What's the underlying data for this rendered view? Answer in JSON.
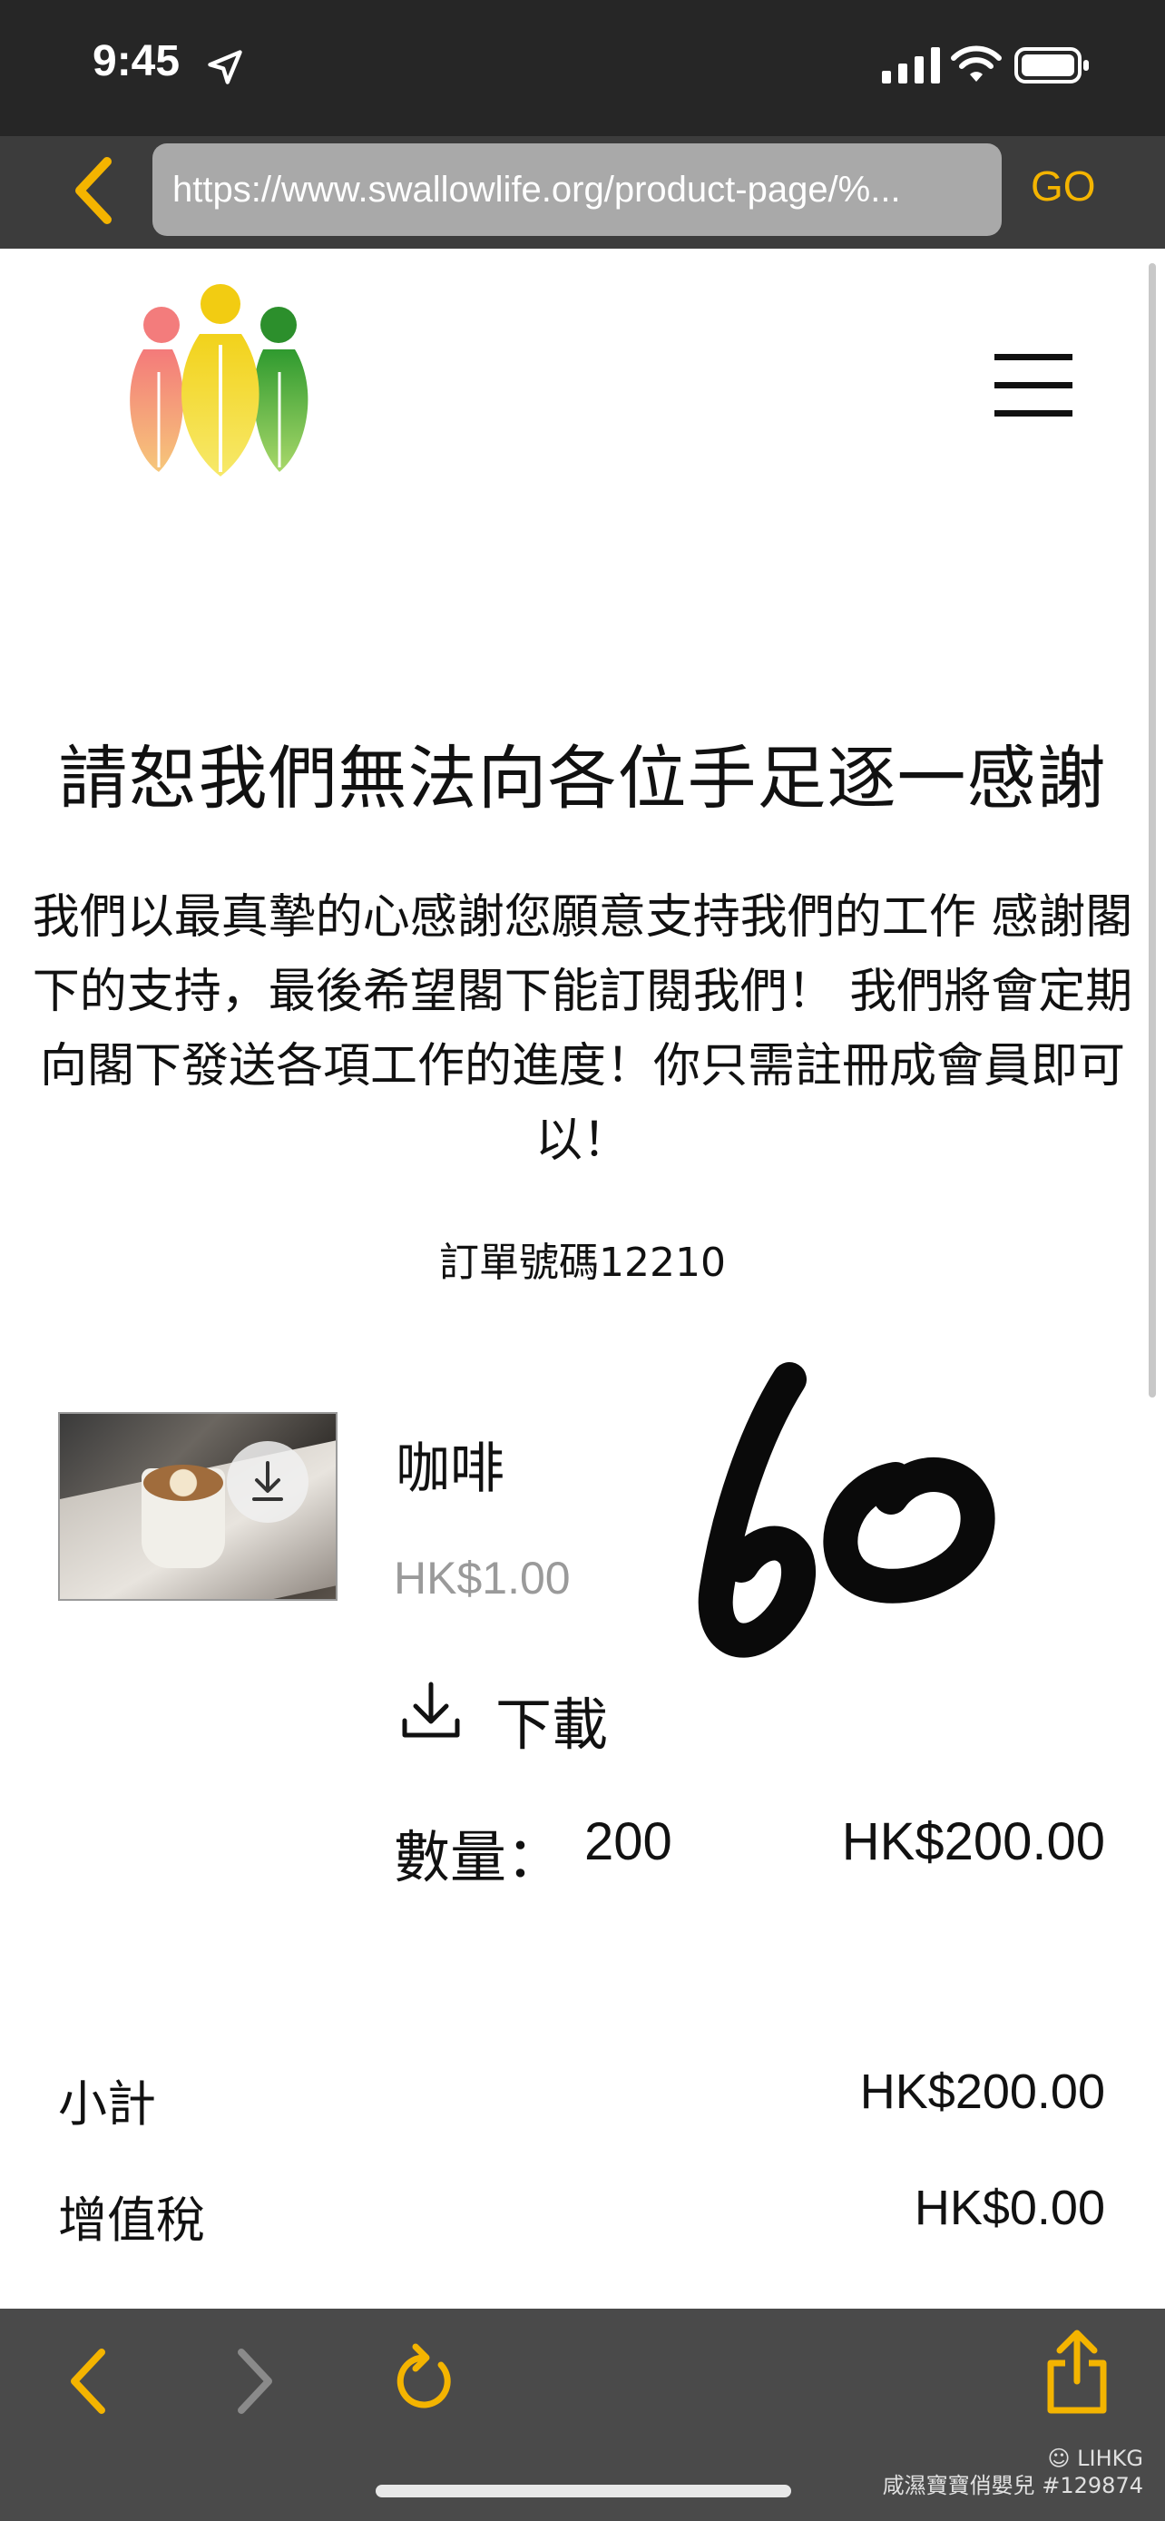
{
  "status_bar": {
    "time": "9:45"
  },
  "browser": {
    "url": "https://www.swallowlife.org/product-page/%...",
    "go_label": "GO"
  },
  "page": {
    "title": "請恕我們無法向各位手足逐一感謝",
    "description": "我們以最真摯的心感謝您願意支持我們的工作 感謝閣下的支持，最後希望閣下能訂閱我們！ 我們將會定期向閣下發送各項工作的進度！你只需註冊成會員即可以！",
    "order_number": "訂單號碼12210"
  },
  "product": {
    "name": "咖啡",
    "price": "HK$1.00",
    "download_label": "下載",
    "quantity_label": "數量：",
    "quantity": "200",
    "line_total": "HK$200.00",
    "handwritten_annotation": "60"
  },
  "summary": {
    "subtotal_label": "小計",
    "subtotal_value": "HK$200.00",
    "tax_label": "增值稅",
    "tax_value": "HK$0.00"
  },
  "watermark": {
    "brand": "☺ LIHKG",
    "user": "咸濕寶寶俏嬰兒 #129874"
  },
  "colors": {
    "accent": "#f4b400",
    "statusbar_bg": "#262626",
    "urlbar_bg": "#3c3c3c",
    "toolbar_bg": "#4a4a4a"
  },
  "icons": [
    "location-arrow-icon",
    "signal-icon",
    "wifi-icon",
    "battery-icon",
    "back-chevron-icon",
    "hamburger-menu-icon",
    "download-icon",
    "forward-chevron-icon",
    "reload-icon",
    "share-icon"
  ]
}
